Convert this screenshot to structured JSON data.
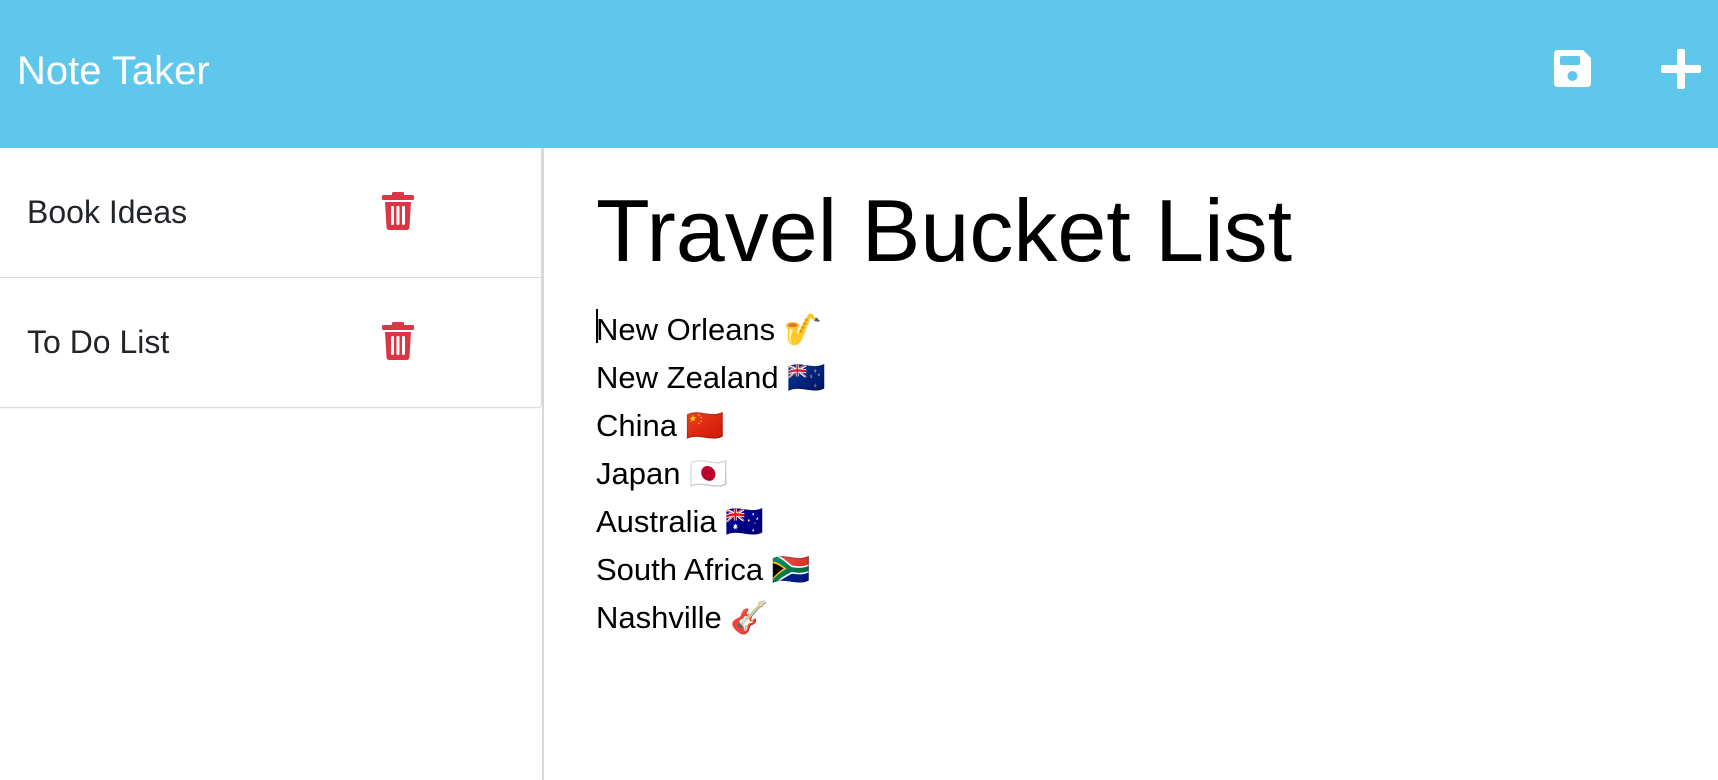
{
  "navbar": {
    "title": "Note Taker",
    "save_icon": "save-icon",
    "new_icon": "plus-icon",
    "background": "#5fc7ec"
  },
  "sidebar": {
    "items": [
      {
        "label": "Book Ideas",
        "icon": "trash-icon"
      },
      {
        "label": "To Do List",
        "icon": "trash-icon"
      }
    ],
    "delete_color": "#dc3545"
  },
  "note": {
    "title": "Travel Bucket List",
    "lines": [
      "New Orleans 🎷",
      "New Zealand 🇳🇿",
      "China 🇨🇳",
      "Japan 🇯🇵",
      "Australia 🇦🇺",
      "South Africa 🇿🇦",
      "Nashville 🎸"
    ]
  }
}
